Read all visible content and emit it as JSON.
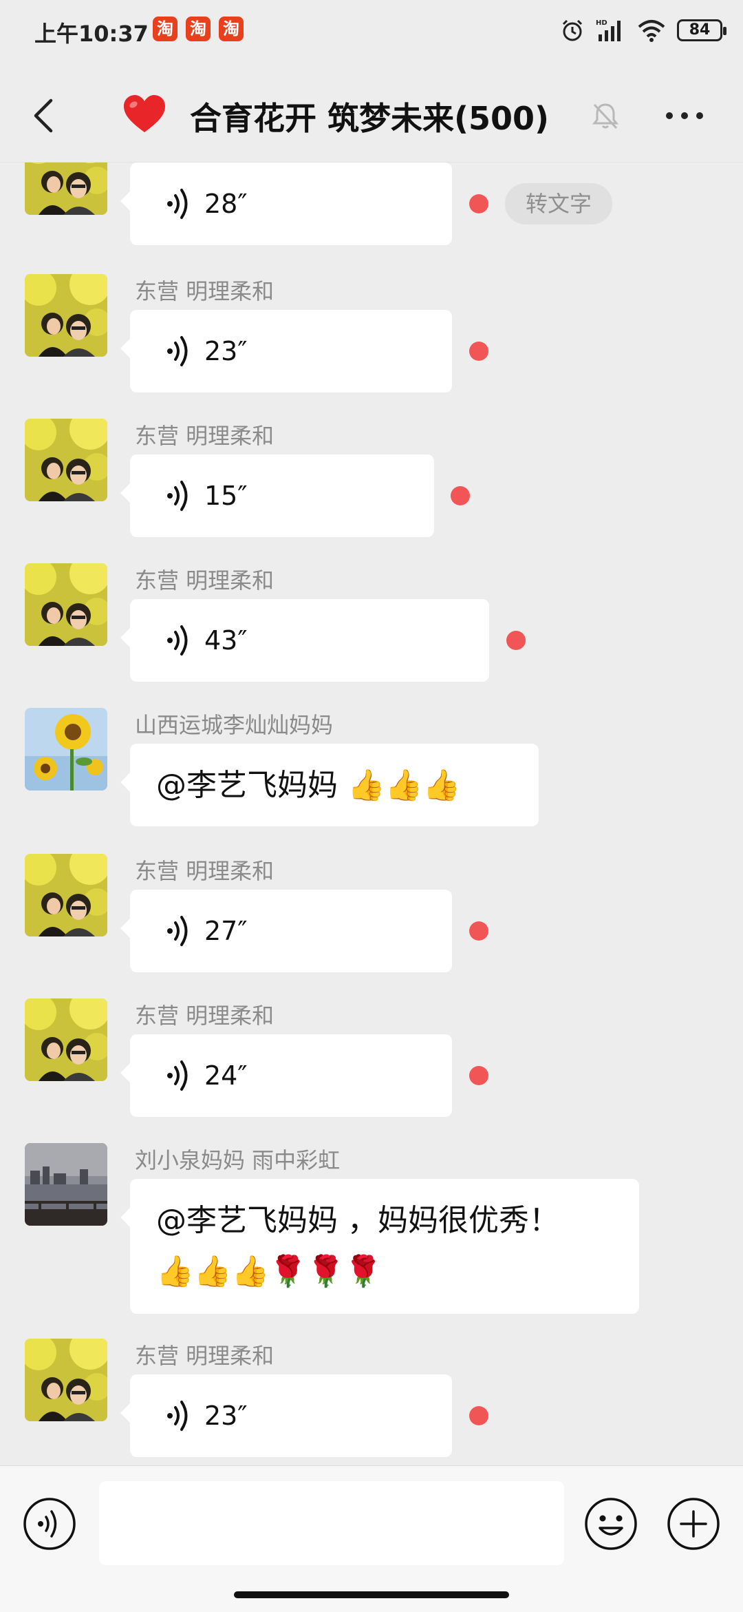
{
  "status_bar": {
    "time": "上午10:37",
    "notif_app_glyph": "淘",
    "notif_app_count": 3,
    "battery": "84",
    "icons": [
      "alarm-icon",
      "signal-icon",
      "wifi-icon",
      "battery-icon"
    ]
  },
  "header": {
    "heart": "❤️",
    "title": "合育花开 筑梦未来(500)",
    "icons": [
      "back-arrow-icon",
      "mute-bell-icon",
      "more-icon"
    ]
  },
  "messages": [
    {
      "type": "voice",
      "sender": "",
      "avatar": "couple-yellow-flowers",
      "duration": "28″",
      "unread": true,
      "extra": "转文字"
    },
    {
      "type": "voice",
      "sender": "东营  明理柔和",
      "avatar": "couple-yellow-flowers",
      "duration": "23″",
      "unread": true
    },
    {
      "type": "voice",
      "sender": "东营  明理柔和",
      "avatar": "couple-yellow-flowers",
      "duration": "15″",
      "unread": true
    },
    {
      "type": "voice",
      "sender": "东营  明理柔和",
      "avatar": "couple-yellow-flowers",
      "duration": "43″",
      "unread": true
    },
    {
      "type": "text",
      "sender": "山西运城李灿灿妈妈",
      "avatar": "sunflower",
      "text": "@李艺飞妈妈 👍👍👍"
    },
    {
      "type": "voice",
      "sender": "东营  明理柔和",
      "avatar": "couple-yellow-flowers",
      "duration": "27″",
      "unread": true
    },
    {
      "type": "voice",
      "sender": "东营  明理柔和",
      "avatar": "couple-yellow-flowers",
      "duration": "24″",
      "unread": true
    },
    {
      "type": "text",
      "sender": "刘小泉妈妈  雨中彩虹",
      "avatar": "lakeside",
      "text_line1": "@李艺飞妈妈 ，妈妈很优秀！",
      "text_line2": "👍👍👍🌹🌹🌹"
    },
    {
      "type": "voice",
      "sender": "东营  明理柔和",
      "avatar": "couple-yellow-flowers",
      "duration": "23″",
      "unread": true
    }
  ],
  "input_bar": {
    "icons": [
      "voice-input-icon",
      "emoji-icon",
      "plus-icon"
    ],
    "placeholder": ""
  },
  "colors": {
    "background": "#ededed",
    "bubble": "#ffffff",
    "unread_dot": "#f25555",
    "sender_text": "#8a8a8a",
    "heart": "#e8262a"
  }
}
